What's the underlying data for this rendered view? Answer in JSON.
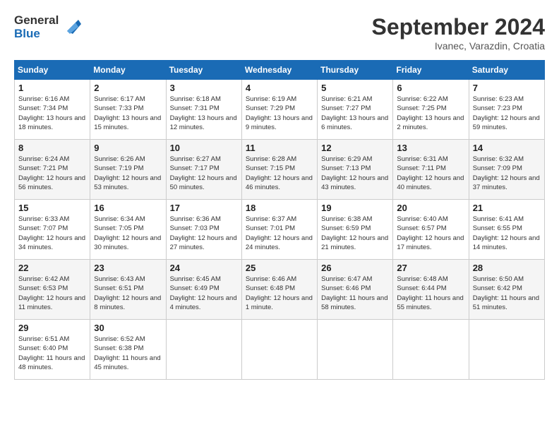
{
  "logo": {
    "line1": "General",
    "line2": "Blue"
  },
  "header": {
    "month": "September 2024",
    "location": "Ivanec, Varazdin, Croatia"
  },
  "weekdays": [
    "Sunday",
    "Monday",
    "Tuesday",
    "Wednesday",
    "Thursday",
    "Friday",
    "Saturday"
  ],
  "weeks": [
    [
      {
        "day": "1",
        "info": "Sunrise: 6:16 AM\nSunset: 7:34 PM\nDaylight: 13 hours and 18 minutes."
      },
      {
        "day": "2",
        "info": "Sunrise: 6:17 AM\nSunset: 7:33 PM\nDaylight: 13 hours and 15 minutes."
      },
      {
        "day": "3",
        "info": "Sunrise: 6:18 AM\nSunset: 7:31 PM\nDaylight: 13 hours and 12 minutes."
      },
      {
        "day": "4",
        "info": "Sunrise: 6:19 AM\nSunset: 7:29 PM\nDaylight: 13 hours and 9 minutes."
      },
      {
        "day": "5",
        "info": "Sunrise: 6:21 AM\nSunset: 7:27 PM\nDaylight: 13 hours and 6 minutes."
      },
      {
        "day": "6",
        "info": "Sunrise: 6:22 AM\nSunset: 7:25 PM\nDaylight: 13 hours and 2 minutes."
      },
      {
        "day": "7",
        "info": "Sunrise: 6:23 AM\nSunset: 7:23 PM\nDaylight: 12 hours and 59 minutes."
      }
    ],
    [
      {
        "day": "8",
        "info": "Sunrise: 6:24 AM\nSunset: 7:21 PM\nDaylight: 12 hours and 56 minutes."
      },
      {
        "day": "9",
        "info": "Sunrise: 6:26 AM\nSunset: 7:19 PM\nDaylight: 12 hours and 53 minutes."
      },
      {
        "day": "10",
        "info": "Sunrise: 6:27 AM\nSunset: 7:17 PM\nDaylight: 12 hours and 50 minutes."
      },
      {
        "day": "11",
        "info": "Sunrise: 6:28 AM\nSunset: 7:15 PM\nDaylight: 12 hours and 46 minutes."
      },
      {
        "day": "12",
        "info": "Sunrise: 6:29 AM\nSunset: 7:13 PM\nDaylight: 12 hours and 43 minutes."
      },
      {
        "day": "13",
        "info": "Sunrise: 6:31 AM\nSunset: 7:11 PM\nDaylight: 12 hours and 40 minutes."
      },
      {
        "day": "14",
        "info": "Sunrise: 6:32 AM\nSunset: 7:09 PM\nDaylight: 12 hours and 37 minutes."
      }
    ],
    [
      {
        "day": "15",
        "info": "Sunrise: 6:33 AM\nSunset: 7:07 PM\nDaylight: 12 hours and 34 minutes."
      },
      {
        "day": "16",
        "info": "Sunrise: 6:34 AM\nSunset: 7:05 PM\nDaylight: 12 hours and 30 minutes."
      },
      {
        "day": "17",
        "info": "Sunrise: 6:36 AM\nSunset: 7:03 PM\nDaylight: 12 hours and 27 minutes."
      },
      {
        "day": "18",
        "info": "Sunrise: 6:37 AM\nSunset: 7:01 PM\nDaylight: 12 hours and 24 minutes."
      },
      {
        "day": "19",
        "info": "Sunrise: 6:38 AM\nSunset: 6:59 PM\nDaylight: 12 hours and 21 minutes."
      },
      {
        "day": "20",
        "info": "Sunrise: 6:40 AM\nSunset: 6:57 PM\nDaylight: 12 hours and 17 minutes."
      },
      {
        "day": "21",
        "info": "Sunrise: 6:41 AM\nSunset: 6:55 PM\nDaylight: 12 hours and 14 minutes."
      }
    ],
    [
      {
        "day": "22",
        "info": "Sunrise: 6:42 AM\nSunset: 6:53 PM\nDaylight: 12 hours and 11 minutes."
      },
      {
        "day": "23",
        "info": "Sunrise: 6:43 AM\nSunset: 6:51 PM\nDaylight: 12 hours and 8 minutes."
      },
      {
        "day": "24",
        "info": "Sunrise: 6:45 AM\nSunset: 6:49 PM\nDaylight: 12 hours and 4 minutes."
      },
      {
        "day": "25",
        "info": "Sunrise: 6:46 AM\nSunset: 6:48 PM\nDaylight: 12 hours and 1 minute."
      },
      {
        "day": "26",
        "info": "Sunrise: 6:47 AM\nSunset: 6:46 PM\nDaylight: 11 hours and 58 minutes."
      },
      {
        "day": "27",
        "info": "Sunrise: 6:48 AM\nSunset: 6:44 PM\nDaylight: 11 hours and 55 minutes."
      },
      {
        "day": "28",
        "info": "Sunrise: 6:50 AM\nSunset: 6:42 PM\nDaylight: 11 hours and 51 minutes."
      }
    ],
    [
      {
        "day": "29",
        "info": "Sunrise: 6:51 AM\nSunset: 6:40 PM\nDaylight: 11 hours and 48 minutes."
      },
      {
        "day": "30",
        "info": "Sunrise: 6:52 AM\nSunset: 6:38 PM\nDaylight: 11 hours and 45 minutes."
      },
      {
        "day": "",
        "info": ""
      },
      {
        "day": "",
        "info": ""
      },
      {
        "day": "",
        "info": ""
      },
      {
        "day": "",
        "info": ""
      },
      {
        "day": "",
        "info": ""
      }
    ]
  ]
}
